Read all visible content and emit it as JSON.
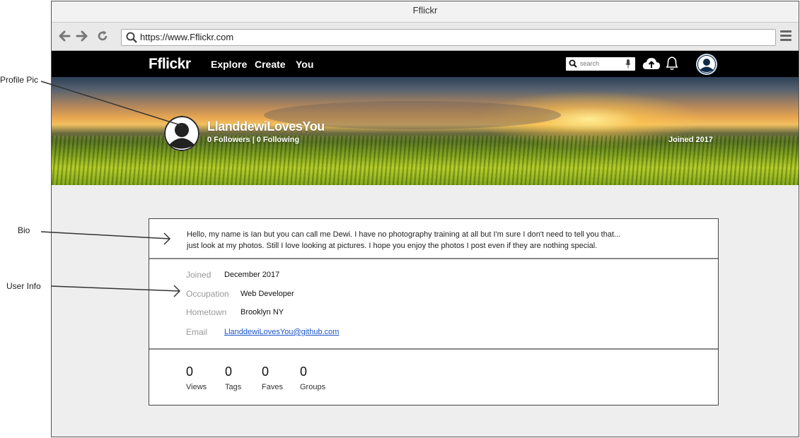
{
  "window": {
    "title": "Fflickr"
  },
  "browser": {
    "url": "https://www.Fflickr.com"
  },
  "site": {
    "logo": "Fflickr",
    "nav": [
      "Explore",
      "Create",
      "You"
    ],
    "search_placeholder": "search"
  },
  "profile": {
    "username": "LlanddewiLovesYou",
    "followers_line": "0 Followers | 0 Following",
    "joined_badge": "Joined 2017",
    "bio_line1": "Hello, my name is Ian but you can call me Dewi. I have no photography training at all but I'm sure I don't need to tell you that...",
    "bio_line2": "just look at my photos. Still I love looking at pictures. I hope you enjoy the photos I post even if they are nothing special."
  },
  "info": [
    {
      "label": "Joined",
      "value": "December 2017"
    },
    {
      "label": "Occupation",
      "value": "Web Developer"
    },
    {
      "label": "Hometown",
      "value": "Brooklyn NY"
    },
    {
      "label": "Email",
      "value": "LlanddewiLovesYou@github.com"
    }
  ],
  "stats": [
    {
      "value": "0",
      "label": "Views"
    },
    {
      "value": "0",
      "label": "Tags"
    },
    {
      "value": "0",
      "label": "Faves"
    },
    {
      "value": "0",
      "label": "Groups"
    }
  ],
  "annotations": [
    "Profile Pic",
    "Bio",
    "User Info"
  ],
  "icons": {
    "back": "arrow-left-icon",
    "forward": "arrow-right-icon",
    "reload": "reload-icon",
    "search": "search-icon",
    "mic": "microphone-icon",
    "upload": "cloud-upload-icon",
    "notifications": "bell-icon",
    "menu": "hamburger-menu-icon"
  }
}
